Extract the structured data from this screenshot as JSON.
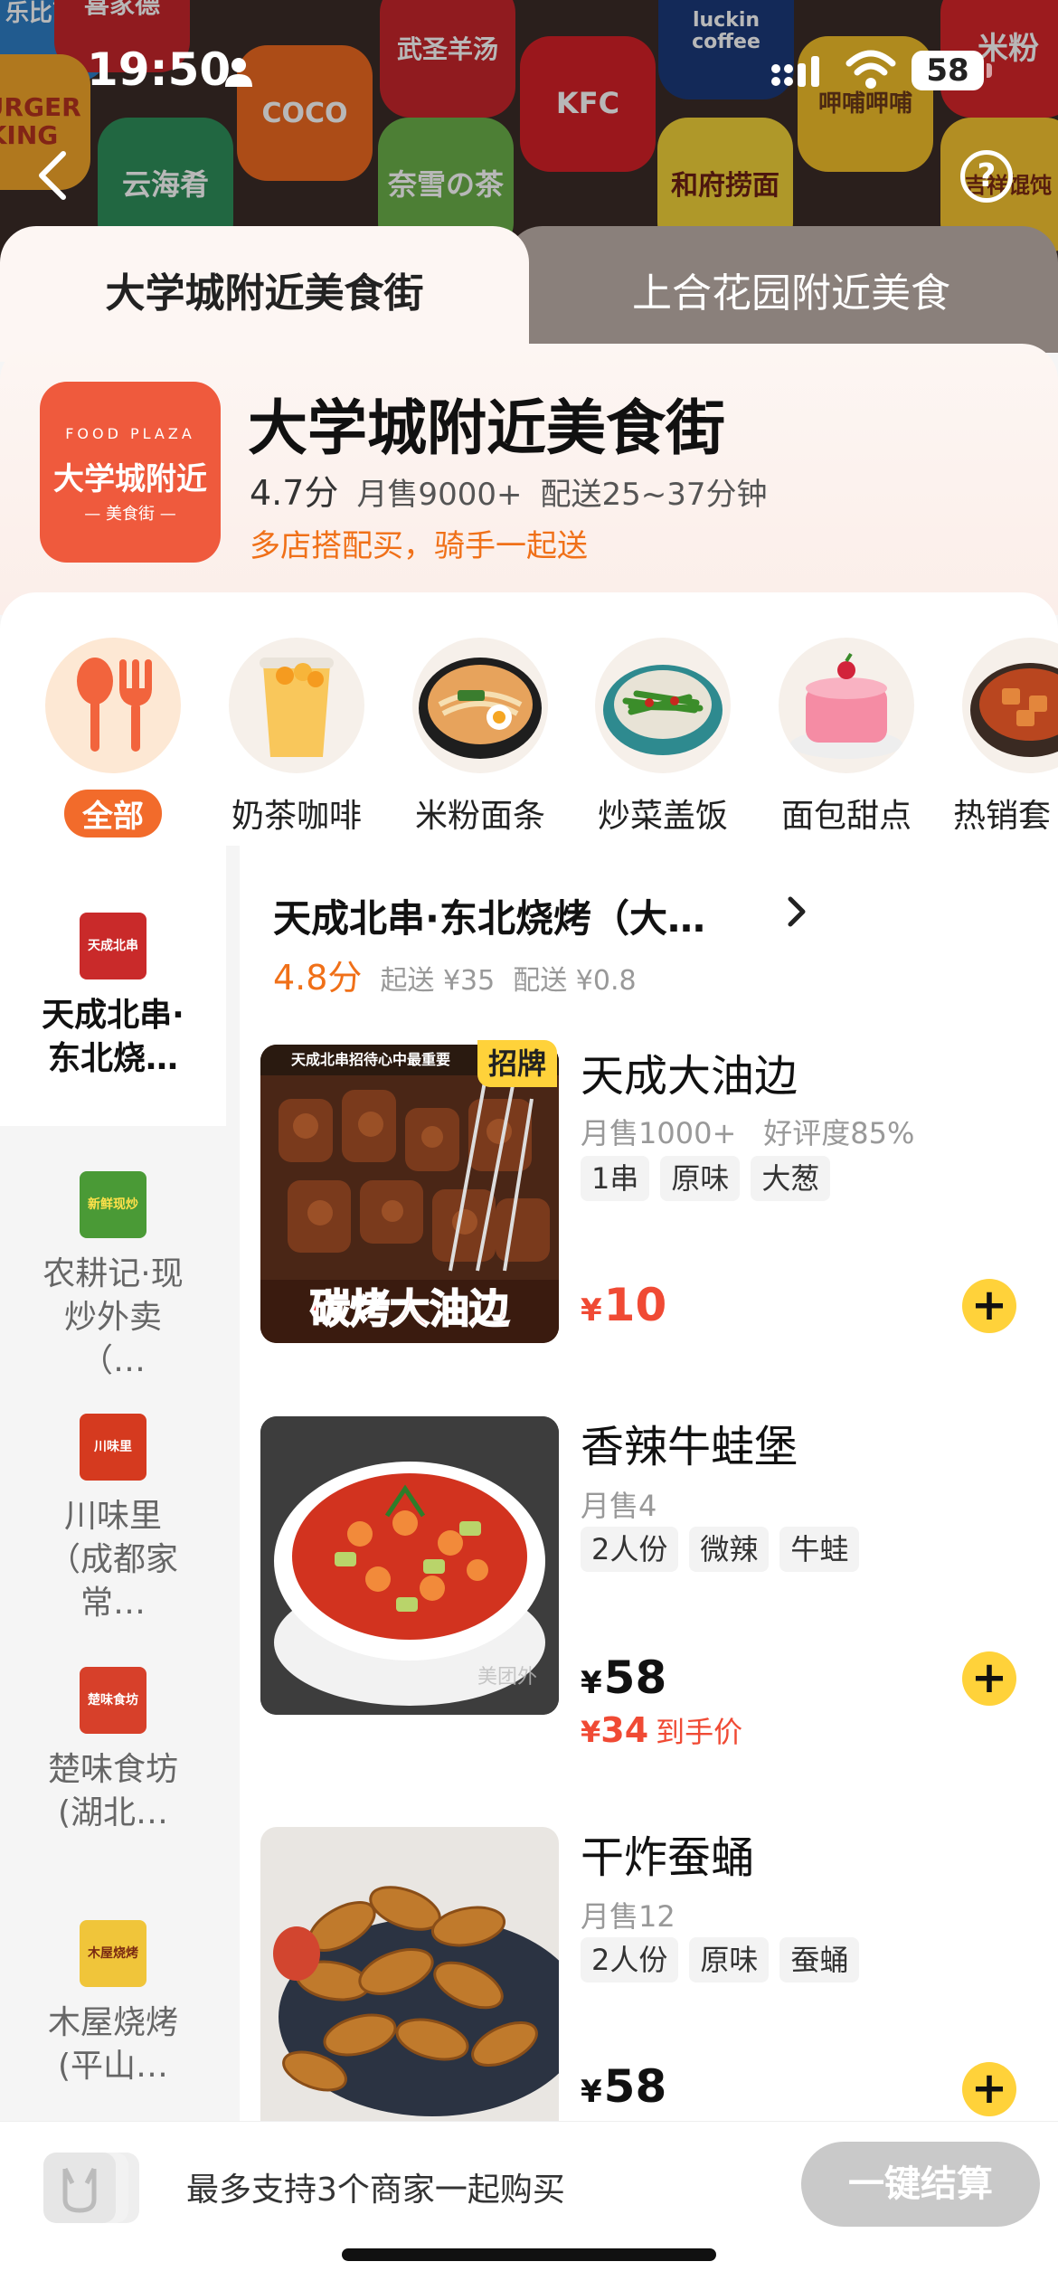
{
  "status": {
    "time": "19:50",
    "battery": "58"
  },
  "hero": {
    "tiles": [
      "乐比萨",
      "喜家德",
      "武圣羊汤",
      "米粉",
      "BURGER KING",
      "COCO",
      "KFC",
      "luckin coffee",
      "呷哺呷哺",
      "云海肴",
      "奈雪の茶",
      "和府捞面",
      "吉祥馄饨"
    ]
  },
  "tabs": {
    "active": "大学城附近美食街",
    "other": "上合花园附近美食"
  },
  "store": {
    "logo_top": "FOOD PLAZA",
    "logo_mid": "大学城附近",
    "logo_bot": "— 美食街 —",
    "name": "大学城附近美食街",
    "rating": "4.7分",
    "monthly": "月售9000+",
    "delivery": "配送25~37分钟",
    "promo": "多店搭配买，骑手一起送"
  },
  "categories": [
    {
      "label": "全部",
      "icon": "utensils-icon"
    },
    {
      "label": "奶茶咖啡",
      "icon": "milk-tea-icon"
    },
    {
      "label": "米粉面条",
      "icon": "noodle-bowl-icon"
    },
    {
      "label": "炒菜盖饭",
      "icon": "stir-fry-icon"
    },
    {
      "label": "面包甜点",
      "icon": "cake-icon"
    },
    {
      "label": "热销套",
      "icon": "combo-icon"
    }
  ],
  "sidebar": {
    "items": [
      {
        "label": "天成北串·东北烧…",
        "logo_text": "天成北串"
      },
      {
        "label": "农耕记·现炒外卖（…",
        "logo_text": "新鲜现炒"
      },
      {
        "label": "川味里（成都家常…",
        "logo_text": "川味里"
      },
      {
        "label": "楚味食坊(湖北…",
        "logo_text": "楚味食坊"
      },
      {
        "label": "木屋烧烤(平山…",
        "logo_text": "木屋烧烤"
      }
    ]
  },
  "shop": {
    "title": "天成北串·东北烧烤（大…",
    "rating": "4.8分",
    "min_order": "起送 ¥35",
    "delivery_fee": "配送 ¥0.8"
  },
  "items": [
    {
      "name": "天成大油边",
      "badge": "招牌",
      "sales": "月售1000+",
      "praise": "好评度85%",
      "tags": [
        "1串",
        "原味",
        "大葱"
      ],
      "yen": "¥",
      "price": "10",
      "img_caption": "碳烤大油边",
      "img_banner": "天成北串招待心中最重要"
    },
    {
      "name": "香辣牛蛙堡",
      "sales": "月售4",
      "tags": [
        "2人份",
        "微辣",
        "牛蛙"
      ],
      "yen": "¥",
      "price": "58",
      "hand_yen": "¥",
      "hand_price": "34",
      "hand_suffix": "到手价",
      "img_watermark": "美团外"
    },
    {
      "name": "干炸蚕蛹",
      "sales": "月售12",
      "tags": [
        "2人份",
        "原味",
        "蚕蛹"
      ],
      "yen": "¥",
      "price": "58"
    }
  ],
  "bottom": {
    "hint": "最多支持3个商家一起购买",
    "checkout": "一键结算"
  },
  "colors": {
    "accent": "#f26b2b",
    "price": "#f04a34",
    "add": "#ffd23a",
    "promo": "#f07018"
  }
}
